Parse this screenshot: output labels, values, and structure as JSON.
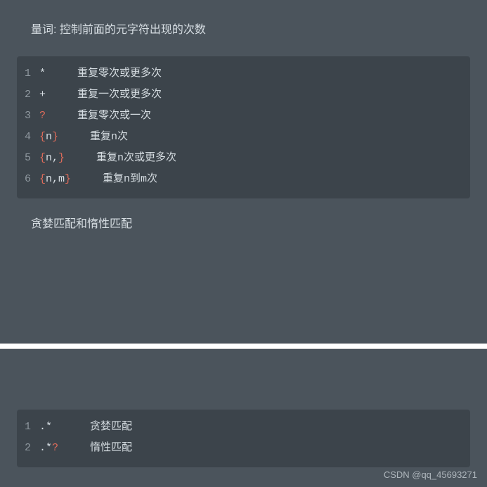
{
  "heading": "量词: 控制前面的元字符出现的次数",
  "block1": {
    "rows": [
      {
        "n": "1",
        "segments": [
          {
            "t": "*     重复零次或更多次",
            "c": ""
          }
        ]
      },
      {
        "n": "2",
        "segments": [
          {
            "t": "+     重复一次或更多次",
            "c": ""
          }
        ]
      },
      {
        "n": "3",
        "segments": [
          {
            "t": "?",
            "c": "red"
          },
          {
            "t": "     重复零次或一次",
            "c": ""
          }
        ]
      },
      {
        "n": "4",
        "segments": [
          {
            "t": "{",
            "c": "red"
          },
          {
            "t": "n",
            "c": ""
          },
          {
            "t": "}",
            "c": "red"
          },
          {
            "t": "     重复n次",
            "c": ""
          }
        ]
      },
      {
        "n": "5",
        "segments": [
          {
            "t": "{",
            "c": "red"
          },
          {
            "t": "n,",
            "c": ""
          },
          {
            "t": "}",
            "c": "red"
          },
          {
            "t": "     重复n次或更多次",
            "c": ""
          }
        ]
      },
      {
        "n": "6",
        "segments": [
          {
            "t": "{",
            "c": "red"
          },
          {
            "t": "n,m",
            "c": ""
          },
          {
            "t": "}",
            "c": "red"
          },
          {
            "t": "     重复n到m次",
            "c": ""
          }
        ]
      }
    ]
  },
  "subheading": "贪婪匹配和惰性匹配",
  "block2": {
    "rows": [
      {
        "n": "1",
        "segments": [
          {
            "t": ".*      贪婪匹配",
            "c": ""
          }
        ]
      },
      {
        "n": "2",
        "segments": [
          {
            "t": ".*",
            "c": ""
          },
          {
            "t": "?",
            "c": "red"
          },
          {
            "t": "     惰性匹配",
            "c": ""
          }
        ]
      }
    ]
  },
  "watermark": "CSDN @qq_45693271"
}
